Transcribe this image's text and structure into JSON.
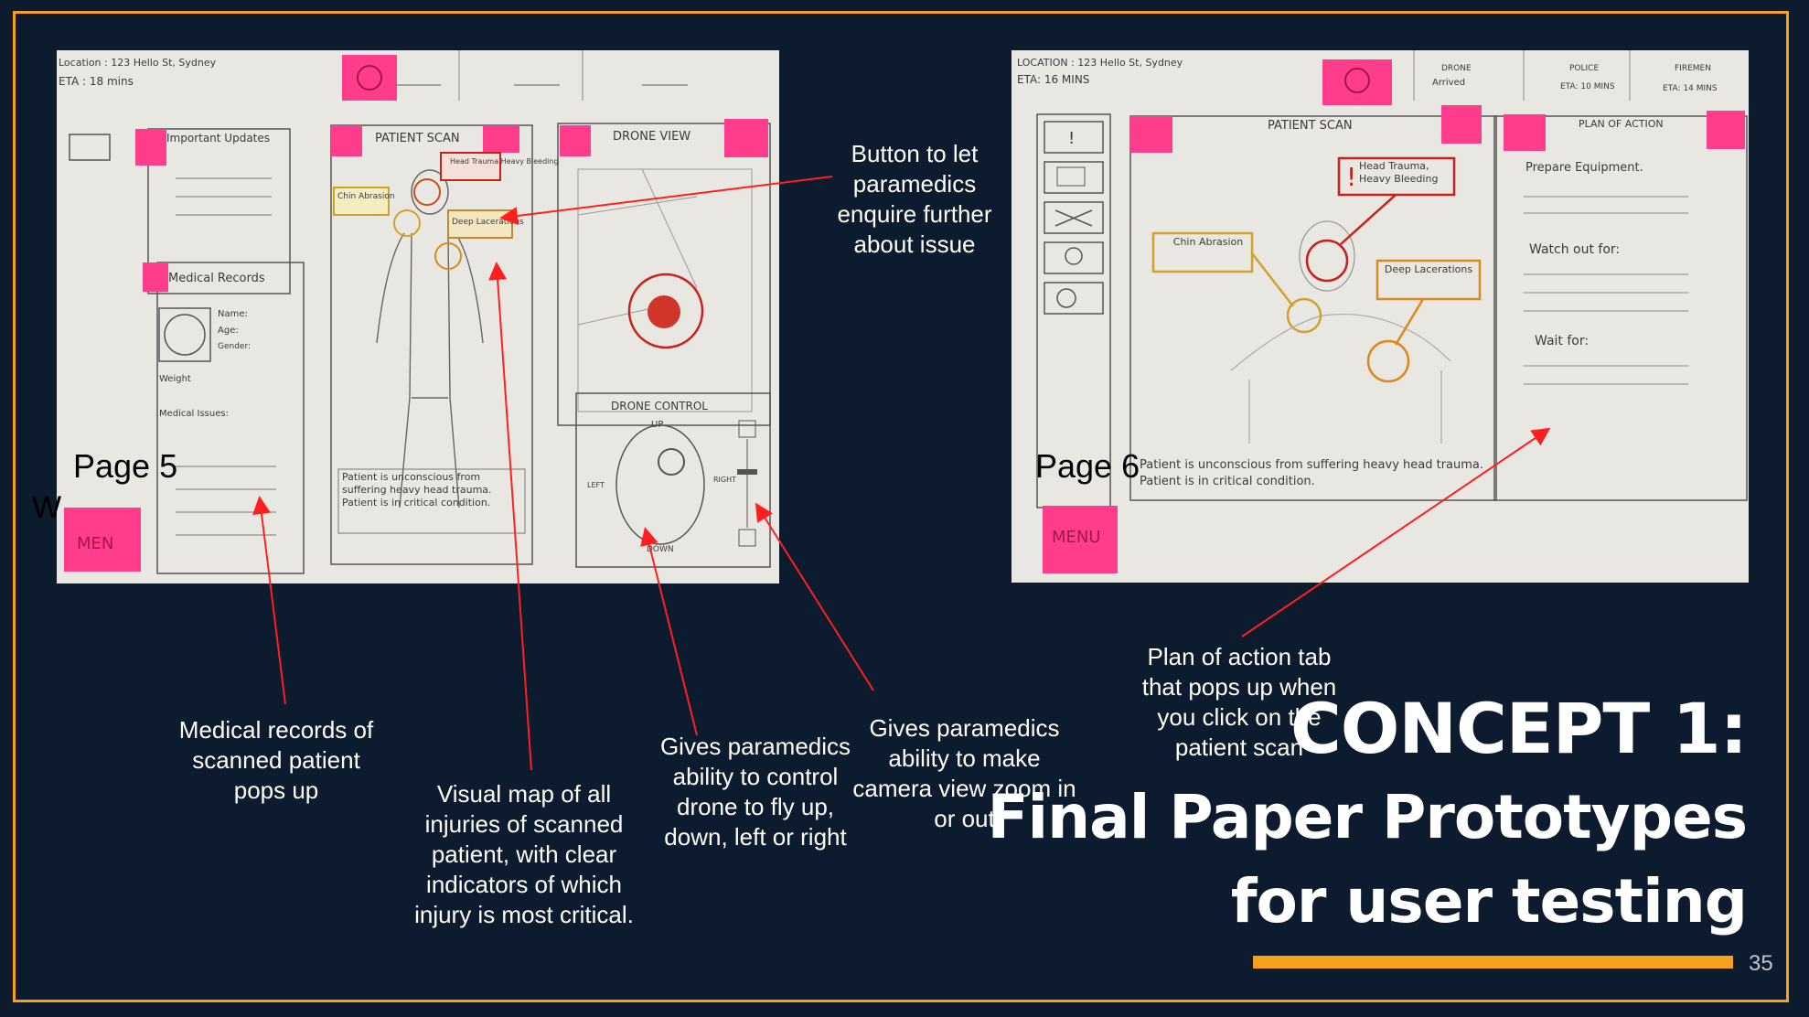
{
  "slide": {
    "title_line1": "CONCEPT 1:",
    "title_line2": "Final Paper Prototypes",
    "title_line3": "for user testing",
    "page_number": "35",
    "accent_color": "#f5a11b",
    "background_color": "#0c1b2e"
  },
  "page5": {
    "label": "Page 5",
    "location": "Location : 123 Hello St, Sydney",
    "eta": "ETA : 18 mins",
    "important_updates": "Important Updates",
    "patient_scan": "PATIENT SCAN",
    "drone_view": "DRONE VIEW",
    "medical_records": "Medical Records",
    "name": "Name:",
    "age": "Age:",
    "gender": "Gender:",
    "weight": "Weight",
    "medical_issues": "Medical Issues:",
    "chin": "Chin Abrasion",
    "head": "Head Trauma Heavy Bleeding",
    "deep": "Deep Lacerations",
    "patient_note": "Patient is unconscious from suffering heavy head trauma. Patient is in critical condition.",
    "drone_control": "DRONE CONTROL",
    "up": "UP",
    "down": "DOWN",
    "left": "LEFT",
    "right": "RIGHT",
    "menu": "MEN",
    "stray_letter": "W"
  },
  "page6": {
    "label": "Page 6",
    "location": "LOCATION : 123 Hello St, Sydney",
    "eta": "ETA: 16 MINS",
    "drone": "DRONE",
    "drone_status": "Arrived",
    "police": "POLICE",
    "police_eta": "ETA: 10 MINS",
    "firemen": "FIREMEN",
    "firemen_eta": "ETA: 14 MINS",
    "patient_scan": "PATIENT SCAN",
    "plan_of_action": "PLAN OF ACTION",
    "prepare": "Prepare Equipment.",
    "watch": "Watch out for:",
    "wait": "Wait for:",
    "chin": "Chin Abrasion",
    "head": "Head Trauma, Heavy Bleeding",
    "deep": "Deep Lacerations",
    "patient_note": "Patient is unconscious from suffering heavy head trauma. Patient is in critical condition.",
    "menu": "MENU"
  },
  "callouts": {
    "button": "Button to let paramedics enquire further about issue",
    "medical": "Medical records of scanned patient pops up",
    "visual_map": "Visual map of all injuries of scanned patient, with clear indicators of which injury is most critical.",
    "drone_control": "Gives paramedics ability to control drone to fly up, down, left or right",
    "zoom": "Gives paramedics ability to make camera view zoom in or out",
    "plan": "Plan of action tab that pops up when you click on the patient scan"
  }
}
